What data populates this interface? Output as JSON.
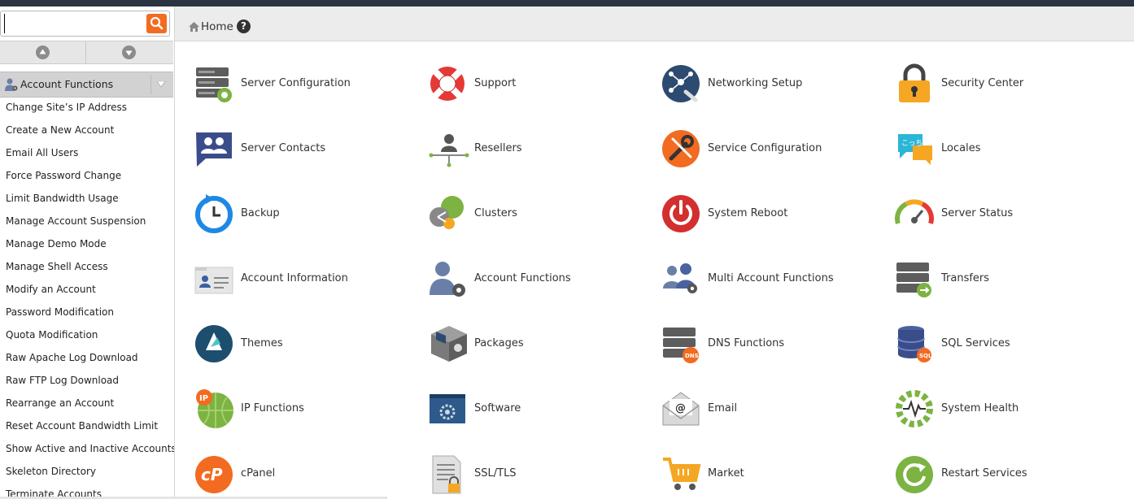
{
  "search": {
    "value": "",
    "placeholder": ""
  },
  "sidebar": {
    "section_label": "Account Functions",
    "items": [
      "Change Site’s IP Address",
      "Create a New Account",
      "Email All Users",
      "Force Password Change",
      "Limit Bandwidth Usage",
      "Manage Account Suspension",
      "Manage Demo Mode",
      "Manage Shell Access",
      "Modify an Account",
      "Password Modification",
      "Quota Modification",
      "Raw Apache Log Download",
      "Raw FTP Log Download",
      "Rearrange an Account",
      "Reset Account Bandwidth Limit",
      "Show Active and Inactive Accounts",
      "Skeleton Directory",
      "Terminate Accounts"
    ]
  },
  "header": {
    "breadcrumb": "Home",
    "help": "?"
  },
  "tiles": [
    {
      "label": "Server Configuration",
      "icon": "server-config-icon"
    },
    {
      "label": "Support",
      "icon": "lifebuoy-icon"
    },
    {
      "label": "Networking Setup",
      "icon": "network-icon"
    },
    {
      "label": "Security Center",
      "icon": "padlock-icon"
    },
    {
      "label": "Server Contacts",
      "icon": "contacts-icon"
    },
    {
      "label": "Resellers",
      "icon": "resellers-icon"
    },
    {
      "label": "Service Configuration",
      "icon": "wrench-icon"
    },
    {
      "label": "Locales",
      "icon": "locales-icon"
    },
    {
      "label": "Backup",
      "icon": "backup-clock-icon"
    },
    {
      "label": "Clusters",
      "icon": "clusters-icon"
    },
    {
      "label": "System Reboot",
      "icon": "power-icon"
    },
    {
      "label": "Server Status",
      "icon": "gauge-icon"
    },
    {
      "label": "Account Information",
      "icon": "account-card-icon"
    },
    {
      "label": "Account Functions",
      "icon": "user-gear-icon"
    },
    {
      "label": "Multi Account Functions",
      "icon": "users-gear-icon"
    },
    {
      "label": "Transfers",
      "icon": "transfer-server-icon"
    },
    {
      "label": "Themes",
      "icon": "themes-icon"
    },
    {
      "label": "Packages",
      "icon": "package-box-icon"
    },
    {
      "label": "DNS Functions",
      "icon": "dns-server-icon"
    },
    {
      "label": "SQL Services",
      "icon": "database-icon"
    },
    {
      "label": "IP Functions",
      "icon": "ip-globe-icon"
    },
    {
      "label": "Software",
      "icon": "software-window-icon"
    },
    {
      "label": "Email",
      "icon": "email-envelope-icon"
    },
    {
      "label": "System Health",
      "icon": "system-health-gear-icon"
    },
    {
      "label": "cPanel",
      "icon": "cpanel-logo-icon"
    },
    {
      "label": "SSL/TLS",
      "icon": "certificate-lock-icon"
    },
    {
      "label": "Market",
      "icon": "shopping-cart-icon"
    },
    {
      "label": "Restart Services",
      "icon": "restart-icon"
    }
  ],
  "colors": {
    "accent": "#f26b21",
    "topbar": "#2a3541",
    "header_bg": "#ececec",
    "section_bg": "#d2d2d2"
  }
}
